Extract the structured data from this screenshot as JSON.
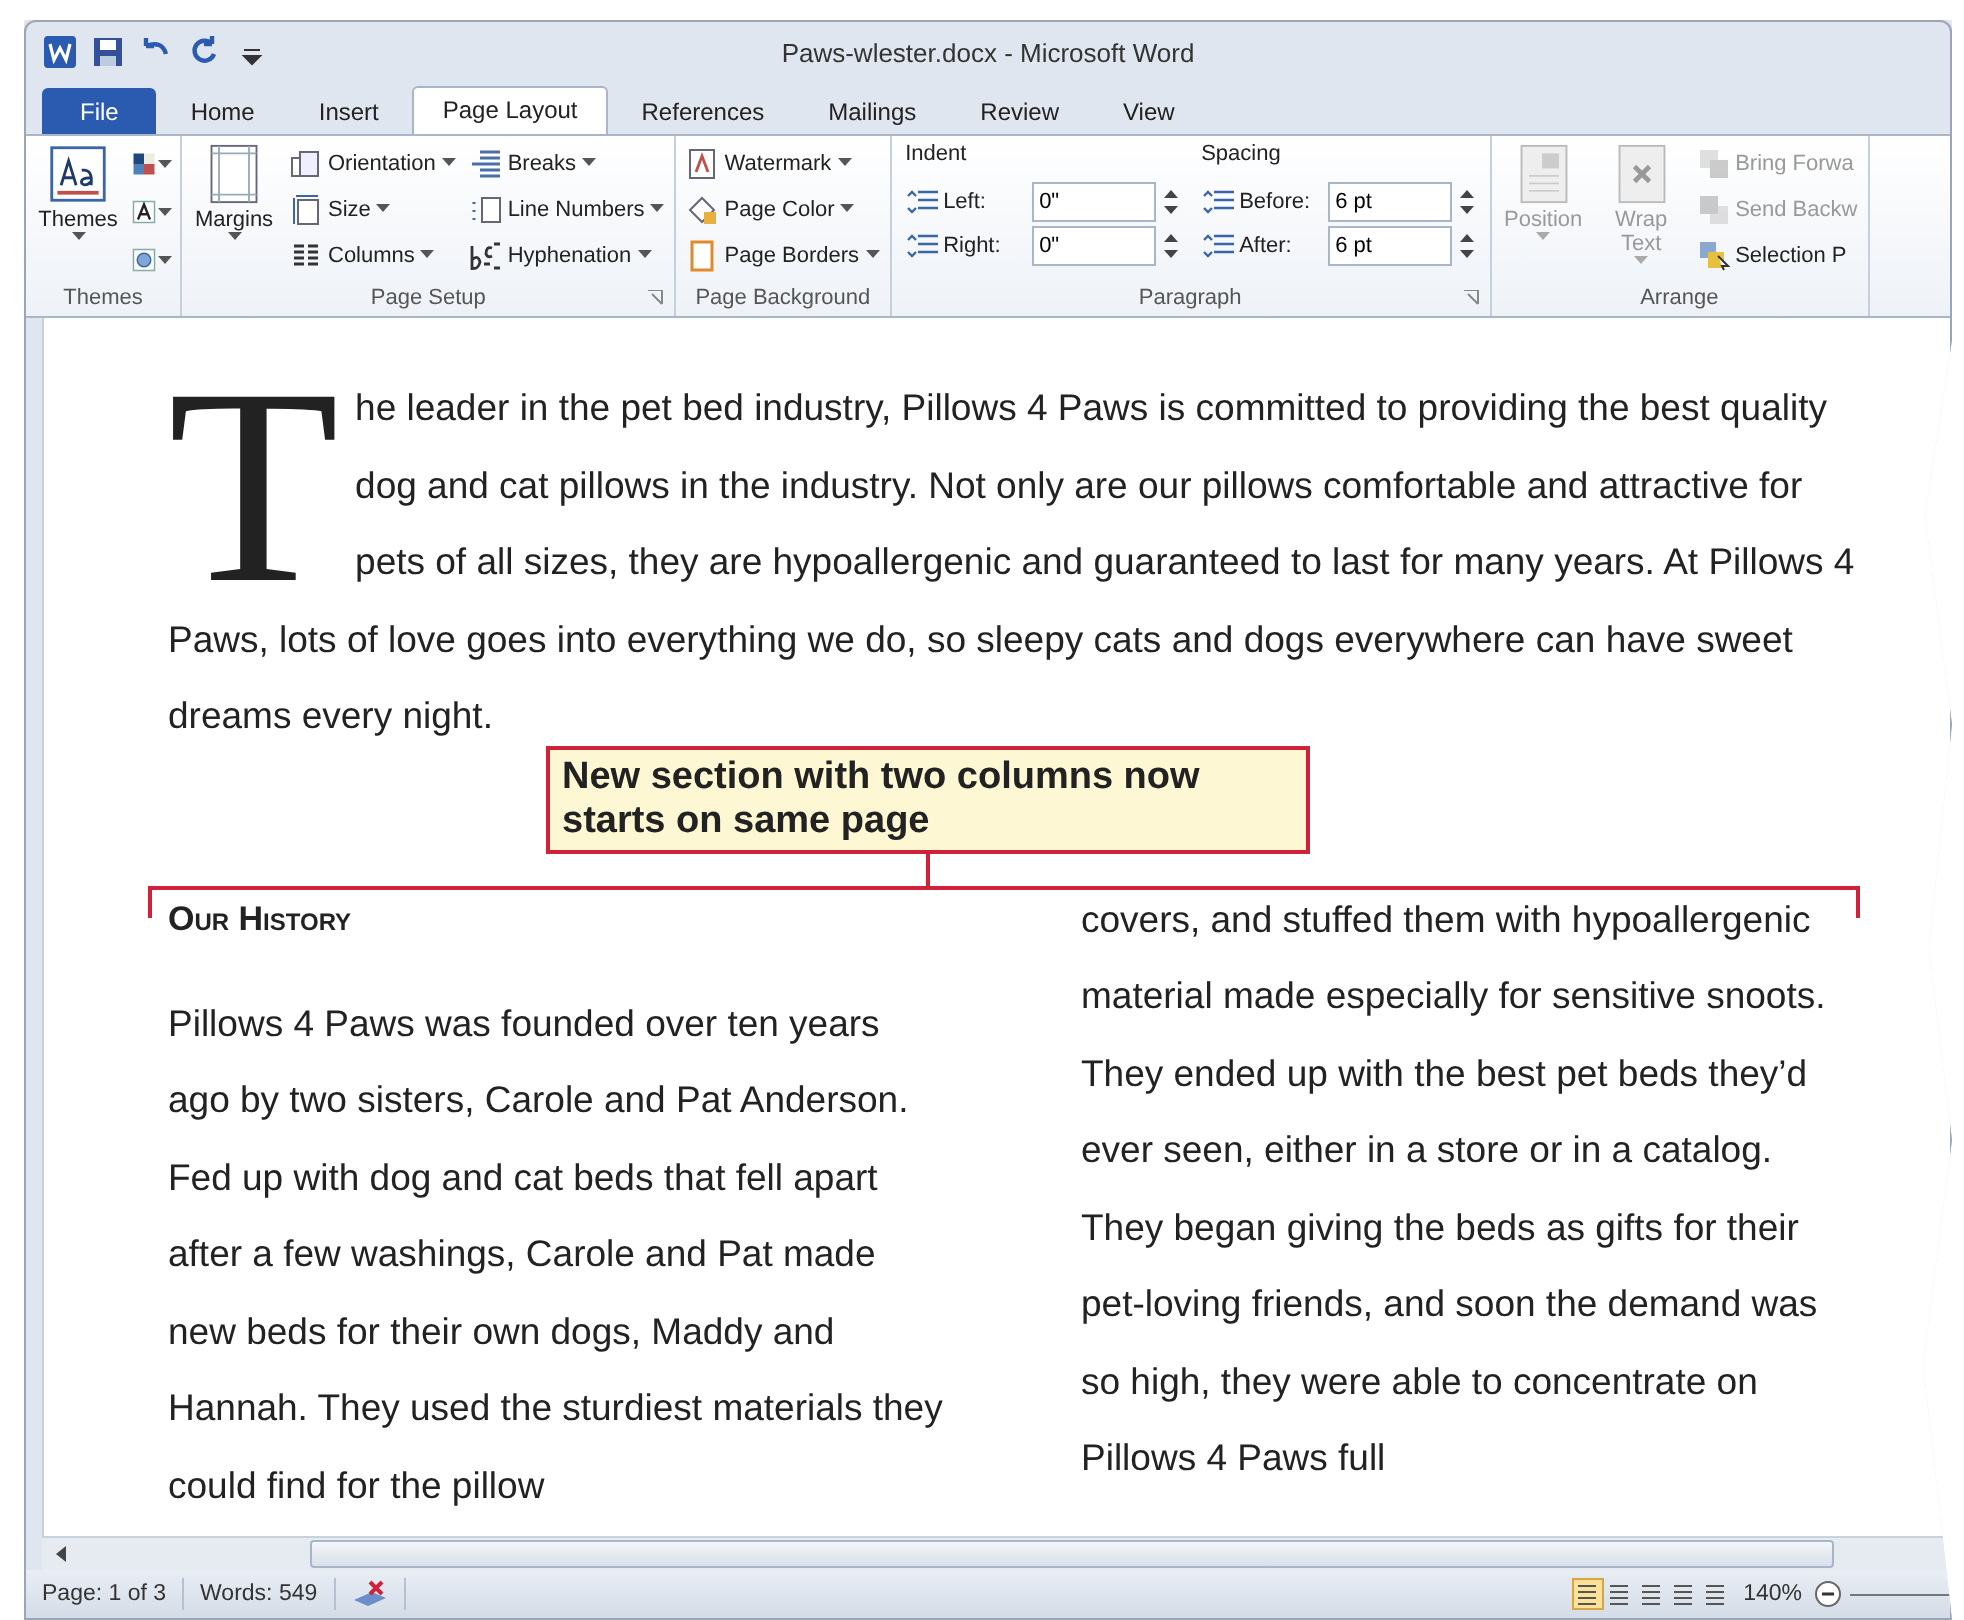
{
  "window": {
    "title": "Paws-wlester.docx - Microsoft Word"
  },
  "tabs": [
    {
      "label": "File",
      "kind": "file",
      "selected": false
    },
    {
      "label": "Home",
      "kind": "tab",
      "selected": false
    },
    {
      "label": "Insert",
      "kind": "tab",
      "selected": false
    },
    {
      "label": "Page Layout",
      "kind": "tab",
      "selected": true
    },
    {
      "label": "References",
      "kind": "tab",
      "selected": false
    },
    {
      "label": "Mailings",
      "kind": "tab",
      "selected": false
    },
    {
      "label": "Review",
      "kind": "tab",
      "selected": false
    },
    {
      "label": "View",
      "kind": "tab",
      "selected": false
    }
  ],
  "ribbon": [
    {
      "label": "Themes",
      "kind": "themes",
      "launcher": false,
      "large": [
        {
          "label": "Themes",
          "disabled": false
        }
      ]
    },
    {
      "label": "Page Setup",
      "kind": "buttons",
      "launcher": true,
      "large": [
        {
          "label": "Margins",
          "disabled": false
        }
      ],
      "small": [
        [
          {
            "label": "Orientation",
            "disabled": false
          },
          {
            "label": "Size",
            "disabled": false
          },
          {
            "label": "Columns",
            "disabled": false
          }
        ],
        [
          {
            "label": "Breaks",
            "disabled": false
          },
          {
            "label": "Line Numbers",
            "disabled": false
          },
          {
            "label": "Hyphenation",
            "disabled": false
          }
        ]
      ]
    },
    {
      "label": "Page Background",
      "kind": "buttons",
      "launcher": false,
      "small": [
        [
          {
            "label": "Watermark",
            "disabled": false
          },
          {
            "label": "Page Color",
            "disabled": false
          },
          {
            "label": "Page Borders",
            "disabled": false
          }
        ]
      ]
    },
    {
      "label": "Paragraph",
      "kind": "fields",
      "launcher": true,
      "sections": [
        {
          "label": "Indent",
          "fields": [
            {
              "label": "Left:",
              "value": "0\""
            },
            {
              "label": "Right:",
              "value": "0\""
            }
          ]
        },
        {
          "label": "Spacing",
          "fields": [
            {
              "label": "Before:",
              "value": "6 pt"
            },
            {
              "label": "After:",
              "value": "6 pt"
            }
          ]
        }
      ]
    },
    {
      "label": "Arrange",
      "kind": "buttons",
      "launcher": false,
      "large": [
        {
          "label": "Position",
          "disabled": true
        },
        {
          "label": "Wrap Text",
          "disabled": true
        }
      ],
      "small": [
        [
          {
            "label": "Bring Forwa",
            "disabled": true
          },
          {
            "label": "Send Backw",
            "disabled": true
          },
          {
            "label": "Selection P",
            "disabled": false
          }
        ]
      ]
    }
  ],
  "document": {
    "drop_cap": "T",
    "intro": "he leader in the pet bed industry, Pillows 4 Paws is committed to providing the best quality dog and cat pillows in the industry. Not only are our pillows comfortable and attractive for pets of all sizes, they are hypoallergenic and guaranteed to last for many years. At Pillows 4 Paws, lots of love goes into everything we do, so sleepy cats and dogs everywhere can have sweet dreams every night.",
    "callout": "New section with two columns now starts on same page",
    "heading": "Our History",
    "columns": [
      "Pillows 4 Paws was founded over ten years ago by two sisters, Carole and Pat Anderson. Fed up with dog and cat beds that fell apart after a few washings, Carole and Pat made new beds for their own dogs, Maddy and Hannah. They used the sturdiest materials they could find for the pillow",
      "covers, and stuffed them with hypoallergenic material made especially for sensitive snoots. They ended up with the best pet beds they’d ever seen, either in a store or in a catalog. They began giving the beds as gifts for their pet-loving friends, and soon the demand was so high, they were able to concentrate on Pillows 4 Paws full"
    ]
  },
  "status_bar": {
    "page": "Page: 1 of 3",
    "words": "Words: 549",
    "zoom": "140%",
    "views": [
      {
        "selected": true
      },
      {
        "selected": false
      },
      {
        "selected": false
      },
      {
        "selected": false
      },
      {
        "selected": false
      }
    ]
  }
}
